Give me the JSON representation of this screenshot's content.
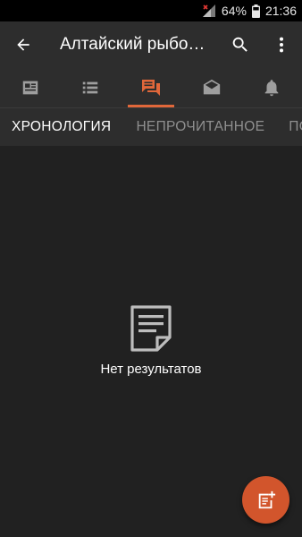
{
  "status_bar": {
    "battery_percent": "64%",
    "time": "21:36",
    "icons": [
      "signal-icon",
      "battery-icon"
    ]
  },
  "app_bar": {
    "title": "Алтайский рыбо…",
    "icons": [
      "back-arrow-icon",
      "search-icon",
      "more-vert-icon"
    ]
  },
  "tabs": [
    {
      "icon": "article-icon",
      "active": false
    },
    {
      "icon": "list-icon",
      "active": false
    },
    {
      "icon": "forum-icon",
      "active": true
    },
    {
      "icon": "drafts-icon",
      "active": false
    },
    {
      "icon": "bell-icon",
      "active": false
    }
  ],
  "sub_tabs": {
    "items": [
      "ХРОНОЛОГИЯ",
      "НЕПРОЧИТАННОЕ",
      "ПОДП"
    ]
  },
  "empty_state": {
    "icon": "note-icon",
    "text": "Нет результатов"
  },
  "fab": {
    "icon": "new-post-icon"
  },
  "colors": {
    "accent": "#e0673a",
    "fab": "#d2552c",
    "background": "#212121",
    "bar": "#2d2d2d"
  }
}
